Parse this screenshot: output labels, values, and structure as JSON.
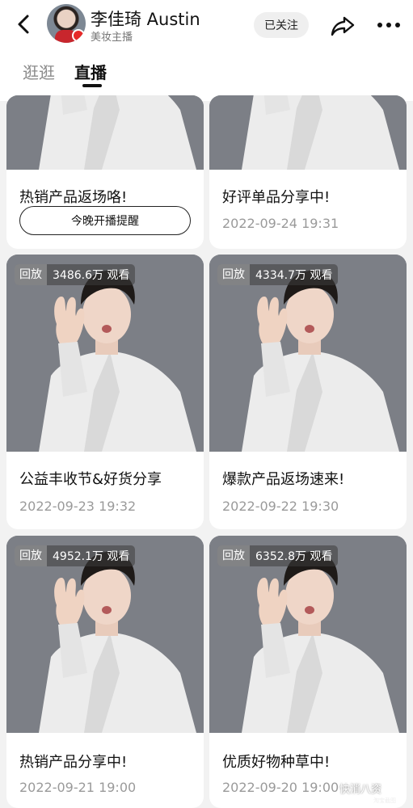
{
  "header": {
    "anchor_name": "李佳琦 Austin",
    "anchor_tag": "美妆主播",
    "follow_label": "已关注",
    "icons": {
      "back": "chevron-left-icon",
      "share": "share-arrow-icon",
      "more": "more-dots-icon",
      "verified": "verified-badge-icon"
    }
  },
  "tabs": [
    {
      "label": "逛逛",
      "active": false
    },
    {
      "label": "直播",
      "active": true
    }
  ],
  "cards": [
    {
      "title": "热销产品返场咯!",
      "button": "今晚开播提醒"
    },
    {
      "title": "好评单品分享中!",
      "time": "2022-09-24 19:31"
    },
    {
      "replay": "回放",
      "views": "3486.6万 观看",
      "title": "公益丰收节&好货分享",
      "time": "2022-09-23 19:32"
    },
    {
      "replay": "回放",
      "views": "4334.7万 观看",
      "title": "爆款产品返场速来!",
      "time": "2022-09-22 19:30"
    },
    {
      "replay": "回放",
      "views": "4952.1万 观看",
      "title": "热销产品分享中!",
      "time": "2022-09-21 19:00"
    },
    {
      "replay": "回放",
      "views": "6352.8万 观看",
      "title": "优质好物种草中!",
      "time": "2022-09-20 19:00"
    }
  ],
  "watermark": {
    "text": "快消八资",
    "sub": "淘宝截图"
  },
  "colors": {
    "accent": "#e62a2a",
    "cover_bg": "#7c7f86",
    "page_bg": "#f2f2f2"
  }
}
